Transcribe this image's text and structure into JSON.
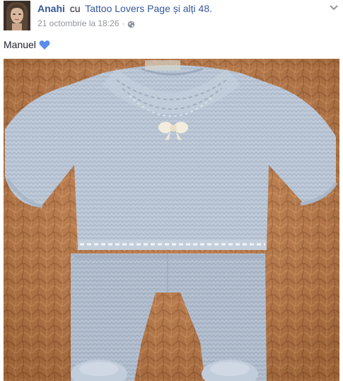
{
  "post": {
    "author": "Anahi",
    "with_word": "cu",
    "page_name": "Tattoo Lovers Page",
    "others": "și alți 48.",
    "timestamp": "21 octombrie la 18:26",
    "dot": "·",
    "privacy_icon": "globe-icon",
    "options_icon": "chevron-down-icon",
    "message": "Manuel",
    "emoji": "blue-heart-icon",
    "colors": {
      "link": "#365899",
      "meta": "#90949c",
      "heart": "#5b8def"
    }
  }
}
